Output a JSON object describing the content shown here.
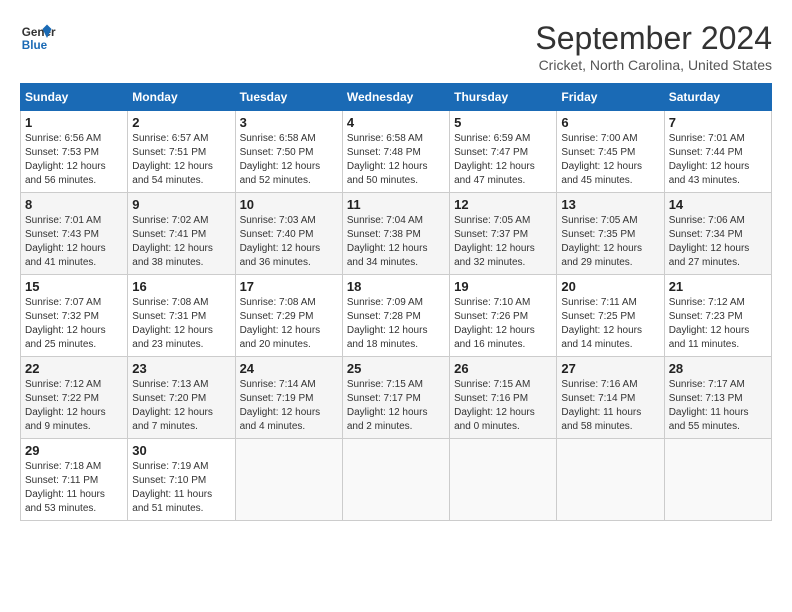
{
  "logo": {
    "line1": "General",
    "line2": "Blue"
  },
  "title": "September 2024",
  "subtitle": "Cricket, North Carolina, United States",
  "headers": [
    "Sunday",
    "Monday",
    "Tuesday",
    "Wednesday",
    "Thursday",
    "Friday",
    "Saturday"
  ],
  "weeks": [
    [
      {
        "day": "1",
        "info": "Sunrise: 6:56 AM\nSunset: 7:53 PM\nDaylight: 12 hours\nand 56 minutes."
      },
      {
        "day": "2",
        "info": "Sunrise: 6:57 AM\nSunset: 7:51 PM\nDaylight: 12 hours\nand 54 minutes."
      },
      {
        "day": "3",
        "info": "Sunrise: 6:58 AM\nSunset: 7:50 PM\nDaylight: 12 hours\nand 52 minutes."
      },
      {
        "day": "4",
        "info": "Sunrise: 6:58 AM\nSunset: 7:48 PM\nDaylight: 12 hours\nand 50 minutes."
      },
      {
        "day": "5",
        "info": "Sunrise: 6:59 AM\nSunset: 7:47 PM\nDaylight: 12 hours\nand 47 minutes."
      },
      {
        "day": "6",
        "info": "Sunrise: 7:00 AM\nSunset: 7:45 PM\nDaylight: 12 hours\nand 45 minutes."
      },
      {
        "day": "7",
        "info": "Sunrise: 7:01 AM\nSunset: 7:44 PM\nDaylight: 12 hours\nand 43 minutes."
      }
    ],
    [
      {
        "day": "8",
        "info": "Sunrise: 7:01 AM\nSunset: 7:43 PM\nDaylight: 12 hours\nand 41 minutes."
      },
      {
        "day": "9",
        "info": "Sunrise: 7:02 AM\nSunset: 7:41 PM\nDaylight: 12 hours\nand 38 minutes."
      },
      {
        "day": "10",
        "info": "Sunrise: 7:03 AM\nSunset: 7:40 PM\nDaylight: 12 hours\nand 36 minutes."
      },
      {
        "day": "11",
        "info": "Sunrise: 7:04 AM\nSunset: 7:38 PM\nDaylight: 12 hours\nand 34 minutes."
      },
      {
        "day": "12",
        "info": "Sunrise: 7:05 AM\nSunset: 7:37 PM\nDaylight: 12 hours\nand 32 minutes."
      },
      {
        "day": "13",
        "info": "Sunrise: 7:05 AM\nSunset: 7:35 PM\nDaylight: 12 hours\nand 29 minutes."
      },
      {
        "day": "14",
        "info": "Sunrise: 7:06 AM\nSunset: 7:34 PM\nDaylight: 12 hours\nand 27 minutes."
      }
    ],
    [
      {
        "day": "15",
        "info": "Sunrise: 7:07 AM\nSunset: 7:32 PM\nDaylight: 12 hours\nand 25 minutes."
      },
      {
        "day": "16",
        "info": "Sunrise: 7:08 AM\nSunset: 7:31 PM\nDaylight: 12 hours\nand 23 minutes."
      },
      {
        "day": "17",
        "info": "Sunrise: 7:08 AM\nSunset: 7:29 PM\nDaylight: 12 hours\nand 20 minutes."
      },
      {
        "day": "18",
        "info": "Sunrise: 7:09 AM\nSunset: 7:28 PM\nDaylight: 12 hours\nand 18 minutes."
      },
      {
        "day": "19",
        "info": "Sunrise: 7:10 AM\nSunset: 7:26 PM\nDaylight: 12 hours\nand 16 minutes."
      },
      {
        "day": "20",
        "info": "Sunrise: 7:11 AM\nSunset: 7:25 PM\nDaylight: 12 hours\nand 14 minutes."
      },
      {
        "day": "21",
        "info": "Sunrise: 7:12 AM\nSunset: 7:23 PM\nDaylight: 12 hours\nand 11 minutes."
      }
    ],
    [
      {
        "day": "22",
        "info": "Sunrise: 7:12 AM\nSunset: 7:22 PM\nDaylight: 12 hours\nand 9 minutes."
      },
      {
        "day": "23",
        "info": "Sunrise: 7:13 AM\nSunset: 7:20 PM\nDaylight: 12 hours\nand 7 minutes."
      },
      {
        "day": "24",
        "info": "Sunrise: 7:14 AM\nSunset: 7:19 PM\nDaylight: 12 hours\nand 4 minutes."
      },
      {
        "day": "25",
        "info": "Sunrise: 7:15 AM\nSunset: 7:17 PM\nDaylight: 12 hours\nand 2 minutes."
      },
      {
        "day": "26",
        "info": "Sunrise: 7:15 AM\nSunset: 7:16 PM\nDaylight: 12 hours\nand 0 minutes."
      },
      {
        "day": "27",
        "info": "Sunrise: 7:16 AM\nSunset: 7:14 PM\nDaylight: 11 hours\nand 58 minutes."
      },
      {
        "day": "28",
        "info": "Sunrise: 7:17 AM\nSunset: 7:13 PM\nDaylight: 11 hours\nand 55 minutes."
      }
    ],
    [
      {
        "day": "29",
        "info": "Sunrise: 7:18 AM\nSunset: 7:11 PM\nDaylight: 11 hours\nand 53 minutes."
      },
      {
        "day": "30",
        "info": "Sunrise: 7:19 AM\nSunset: 7:10 PM\nDaylight: 11 hours\nand 51 minutes."
      },
      {
        "day": "",
        "info": ""
      },
      {
        "day": "",
        "info": ""
      },
      {
        "day": "",
        "info": ""
      },
      {
        "day": "",
        "info": ""
      },
      {
        "day": "",
        "info": ""
      }
    ]
  ]
}
